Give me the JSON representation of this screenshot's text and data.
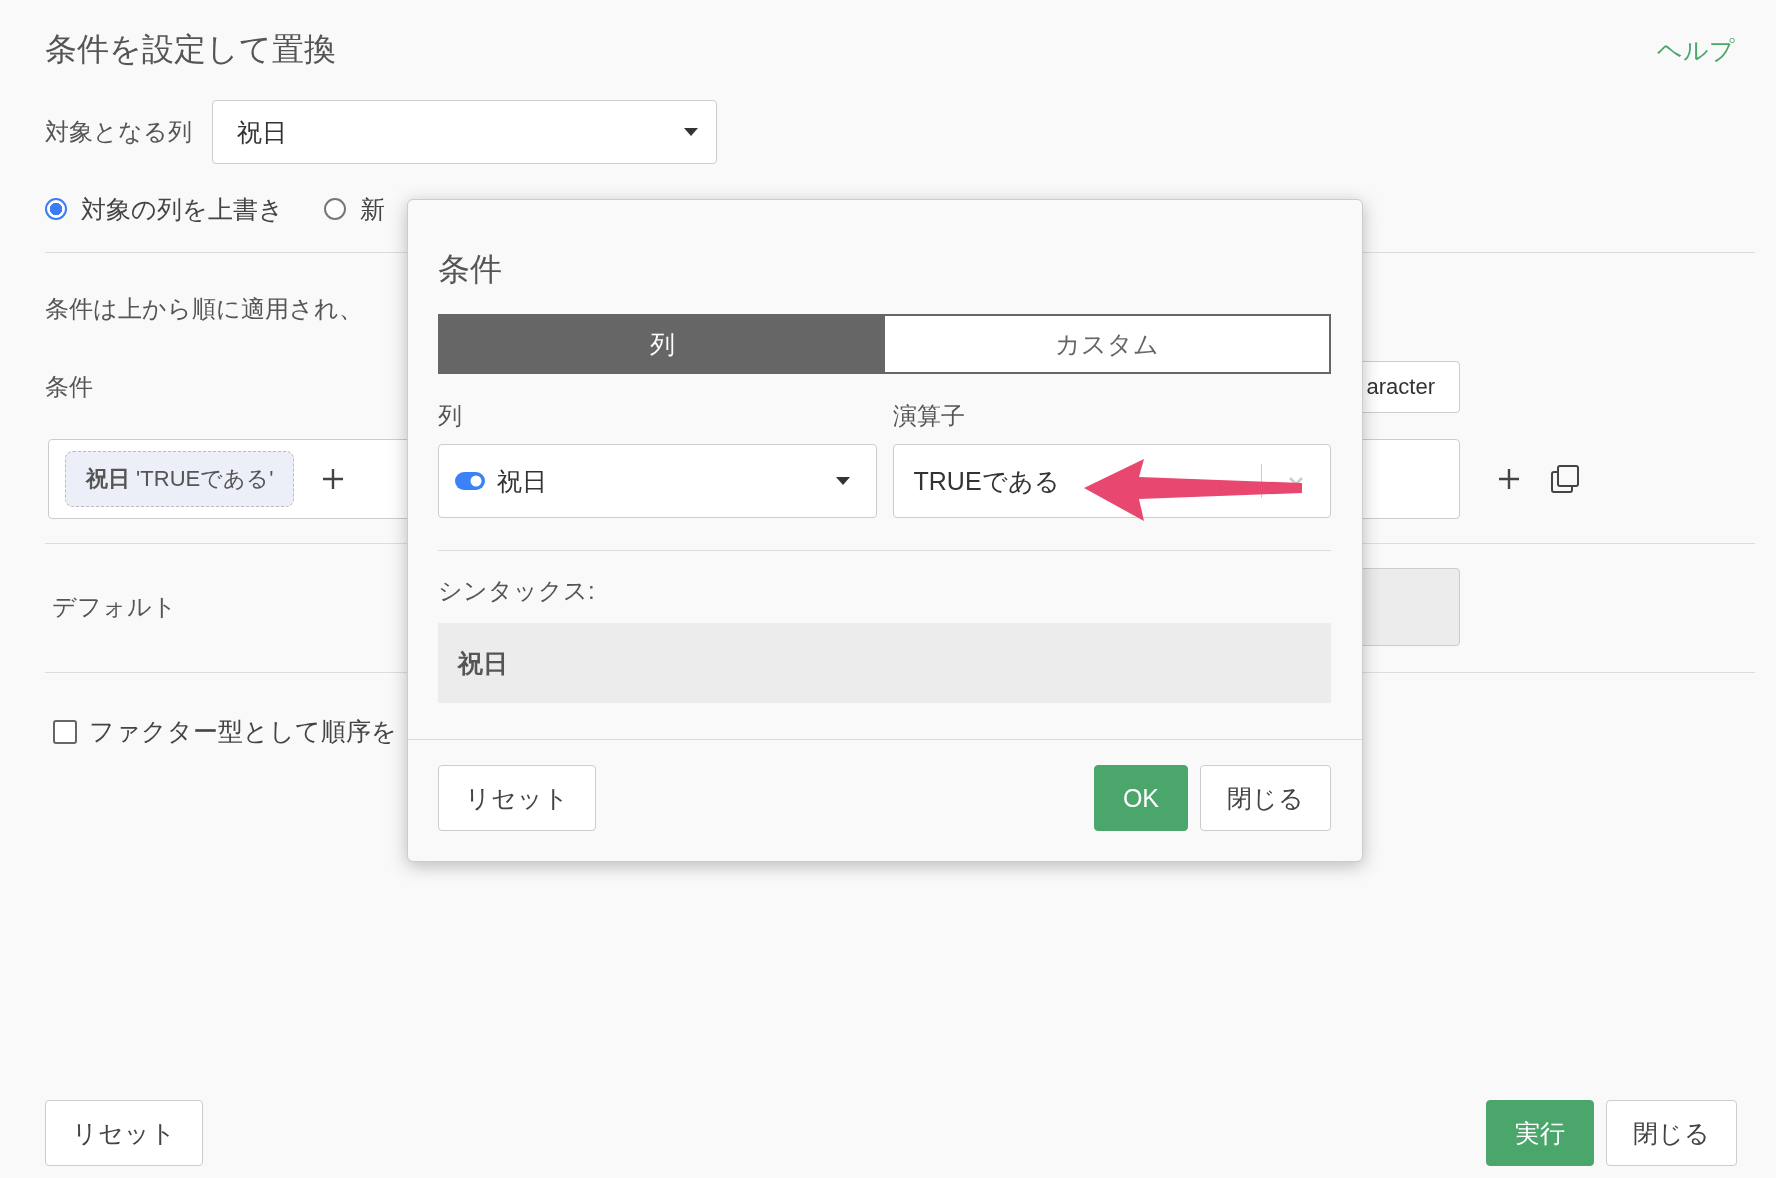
{
  "title": "条件を設定して置換",
  "help_link": "ヘルプ",
  "target_column": {
    "label": "対象となる列",
    "value": "祝日"
  },
  "output_options": [
    {
      "label": "対象の列を上書き",
      "selected": true
    },
    {
      "label": "新",
      "selected": false
    }
  ],
  "description": "条件は上から順に適用され、",
  "conditions": {
    "label": "条件",
    "type_button": "aracter",
    "chip": "**祝日** 'TRUEである'"
  },
  "default": {
    "label": "デフォルト"
  },
  "factor_option": {
    "label": "ファクター型として順序を",
    "checked": false
  },
  "footer": {
    "reset": "リセット",
    "run": "実行",
    "close": "閉じる"
  },
  "dialog": {
    "title": "条件",
    "tabs": [
      {
        "label": "列",
        "selected": true
      },
      {
        "label": "カスタム",
        "selected": false
      }
    ],
    "column_label": "列",
    "column_value": "祝日",
    "operator_label": "演算子",
    "operator_value": "TRUEである",
    "syntax_label": "シンタックス:",
    "syntax": "祝日",
    "reset": "リセット",
    "ok": "OK",
    "close": "閉じる"
  }
}
